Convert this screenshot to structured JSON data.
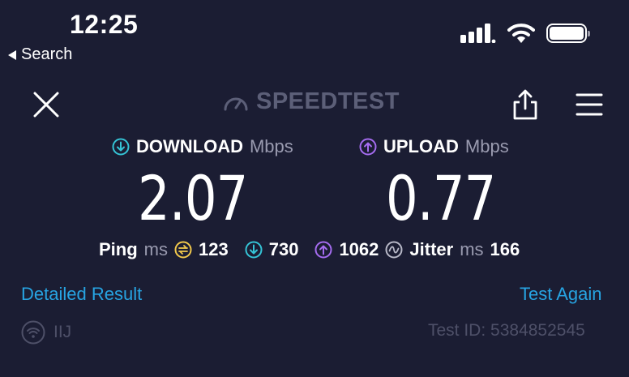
{
  "status_bar": {
    "time": "12:25",
    "back_label": "Search"
  },
  "header": {
    "brand": "SPEEDTEST"
  },
  "download": {
    "label": "DOWNLOAD",
    "unit": "Mbps",
    "value": "2.07",
    "color": "#35c4d6"
  },
  "upload": {
    "label": "UPLOAD",
    "unit": "Mbps",
    "value": "0.77",
    "color": "#a56cf0"
  },
  "ping": {
    "label": "Ping",
    "unit": "ms",
    "idle": "123",
    "download": "730",
    "upload": "1062",
    "jitter_label": "Jitter",
    "jitter_unit": "ms",
    "jitter": "166",
    "idle_color": "#f2c94c"
  },
  "links": {
    "detailed": "Detailed Result",
    "again": "Test Again",
    "color": "#27a4e2"
  },
  "footer": {
    "isp": "IIJ",
    "test_id": "Test ID: 5384852545"
  },
  "icons": [
    "back-arrow-icon",
    "signal-icon",
    "wifi-icon",
    "battery-icon",
    "close-icon",
    "gauge-icon",
    "share-icon",
    "menu-icon",
    "download-arrow-icon",
    "upload-arrow-icon",
    "ping-idle-icon",
    "jitter-icon",
    "wifi-circle-icon"
  ]
}
